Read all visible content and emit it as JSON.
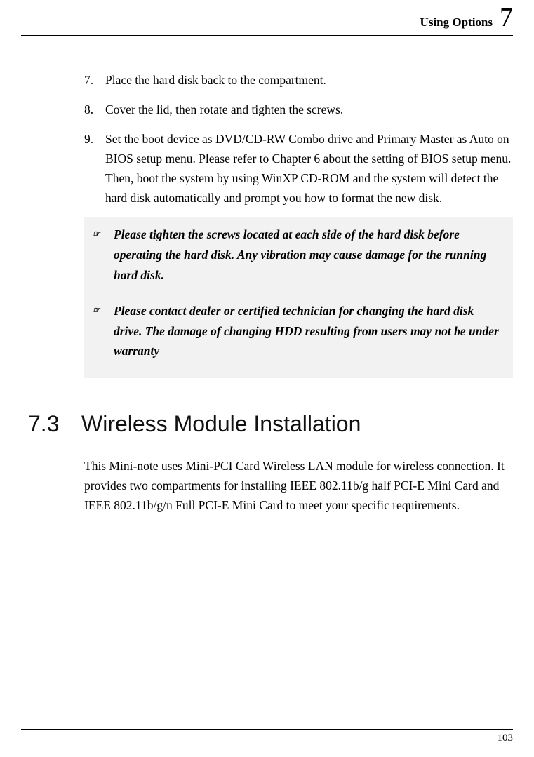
{
  "header": {
    "chapter_title": "Using Options",
    "chapter_number": "7"
  },
  "steps": [
    {
      "num": "7.",
      "text": "Place the hard disk back to the compartment."
    },
    {
      "num": "8.",
      "text": "Cover the lid, then rotate and tighten the screws."
    },
    {
      "num": "9.",
      "text": "Set the boot device as DVD/CD-RW Combo drive and Primary Master as Auto on BIOS setup menu. Please refer to Chapter 6 about the setting of BIOS setup menu. Then, boot the system by using WinXP CD-ROM and the system will detect the hard disk automatically and prompt you how to format the new disk."
    }
  ],
  "notes": [
    "Please tighten the screws located at each side of the hard disk before operating the hard disk. Any vibration may cause damage for the running hard disk.",
    "Please contact dealer or certified technician for changing the hard disk drive. The damage of changing HDD resulting from users may not be under warranty"
  ],
  "section": {
    "number": "7.3",
    "title": "Wireless Module Installation",
    "body": "This Mini-note uses Mini-PCI Card Wireless LAN module for wireless connection. It provides two compartments for installing IEEE 802.11b/g half PCI-E Mini Card and IEEE 802.11b/g/n Full PCI-E Mini Card to meet your specific requirements."
  },
  "footer": {
    "page_number": "103"
  }
}
